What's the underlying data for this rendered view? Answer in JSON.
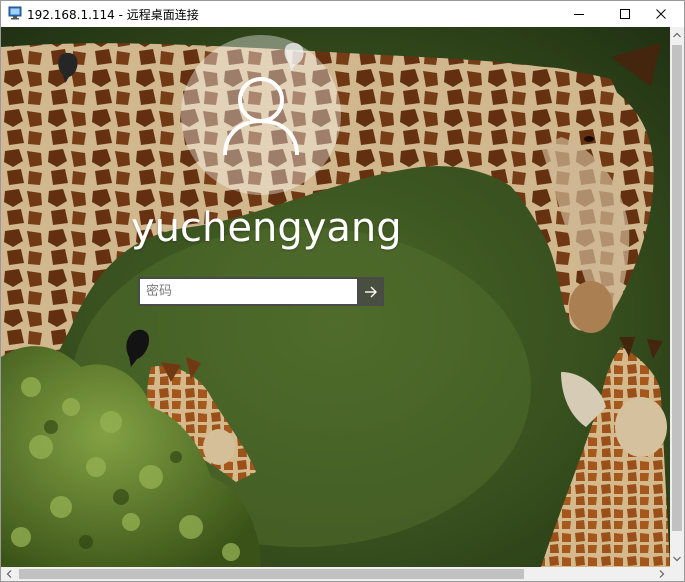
{
  "window": {
    "title": "192.168.1.114 - 远程桌面连接"
  },
  "login": {
    "username": "yuchengyang",
    "password_placeholder": "密码"
  },
  "icons": {
    "app": "remote-desktop-icon",
    "minimize": "minimize-icon",
    "maximize": "maximize-icon",
    "close": "close-icon",
    "avatar": "user-icon",
    "submit": "arrow-right-icon"
  },
  "colors": {
    "overlay_button": "#464646",
    "scrollbar_track": "#f0f0f0",
    "scrollbar_thumb": "#c1c1c1"
  }
}
